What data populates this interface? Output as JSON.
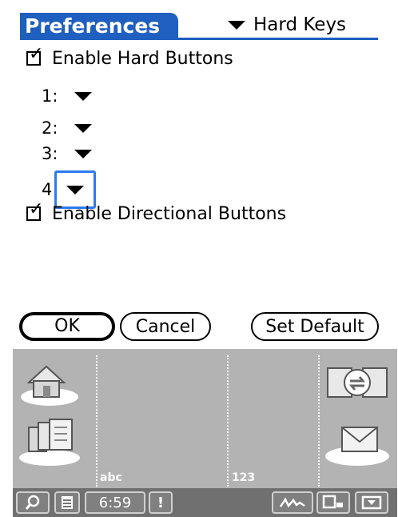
{
  "header": {
    "title": "Preferences",
    "category": "Hard Keys"
  },
  "options": {
    "hard_buttons_label": "Enable Hard Buttons",
    "hard_buttons_checked": true,
    "directional_label": "Enable Directional Buttons",
    "directional_checked": true
  },
  "keys": [
    {
      "label": "1:"
    },
    {
      "label": "2:"
    },
    {
      "label": "3:"
    },
    {
      "label": "4"
    }
  ],
  "buttons": {
    "ok": "OK",
    "cancel": "Cancel",
    "set_default": "Set Default"
  },
  "graffiti": {
    "abc_label": "abc",
    "num_label": "123"
  },
  "status": {
    "time": "6:59"
  },
  "colors": {
    "accent": "#1f5fbf",
    "focus": "#2a7bf0",
    "graffiti_bg": "#b3b3b3"
  },
  "icons": {
    "checkmark": "✓",
    "search": "search-icon",
    "menu": "menu-icon",
    "alert": "!"
  }
}
